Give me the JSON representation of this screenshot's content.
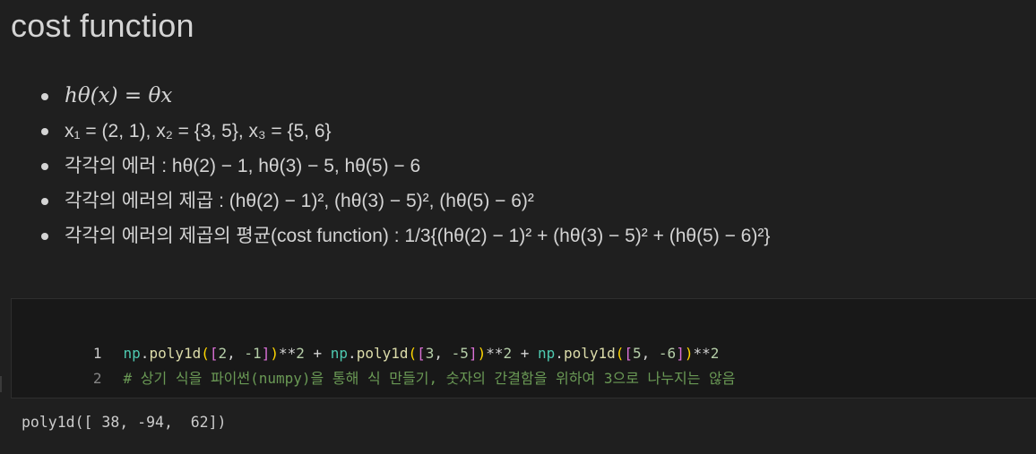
{
  "heading": "cost function",
  "bullets": [
    "hθ(x) = θx",
    "x₁ = (2, 1), x₂ = {3, 5}, x₃ = {5, 6}",
    "각각의 에러 : hθ(2) − 1, hθ(3) − 5, hθ(5) − 6",
    "각각의 에러의 제곱 : (hθ(2) − 1)², (hθ(3) − 5)², (hθ(5) − 6)²",
    "각각의 에러의 제곱의 평균(cost function) : 1/3{(hθ(2) − 1)² + (hθ(3) − 5)² + (hθ(5) − 6)²}"
  ],
  "code_cell": {
    "line_numbers": [
      "1",
      "2"
    ],
    "line1_tokens": [
      {
        "text": "np",
        "cls": "t-var"
      },
      {
        "text": ".",
        "cls": "t-op"
      },
      {
        "text": "poly1d",
        "cls": "t-fn"
      },
      {
        "text": "(",
        "cls": "t-b1"
      },
      {
        "text": "[",
        "cls": "t-b2"
      },
      {
        "text": "2",
        "cls": "t-num"
      },
      {
        "text": ", ",
        "cls": "t-op"
      },
      {
        "text": "-1",
        "cls": "t-num"
      },
      {
        "text": "]",
        "cls": "t-b2"
      },
      {
        "text": ")",
        "cls": "t-b1"
      },
      {
        "text": "**",
        "cls": "t-op"
      },
      {
        "text": "2",
        "cls": "t-num"
      },
      {
        "text": " + ",
        "cls": "t-op"
      },
      {
        "text": "np",
        "cls": "t-var"
      },
      {
        "text": ".",
        "cls": "t-op"
      },
      {
        "text": "poly1d",
        "cls": "t-fn"
      },
      {
        "text": "(",
        "cls": "t-b1"
      },
      {
        "text": "[",
        "cls": "t-b2"
      },
      {
        "text": "3",
        "cls": "t-num"
      },
      {
        "text": ", ",
        "cls": "t-op"
      },
      {
        "text": "-5",
        "cls": "t-num"
      },
      {
        "text": "]",
        "cls": "t-b2"
      },
      {
        "text": ")",
        "cls": "t-b1"
      },
      {
        "text": "**",
        "cls": "t-op"
      },
      {
        "text": "2",
        "cls": "t-num"
      },
      {
        "text": " + ",
        "cls": "t-op"
      },
      {
        "text": "np",
        "cls": "t-var"
      },
      {
        "text": ".",
        "cls": "t-op"
      },
      {
        "text": "poly1d",
        "cls": "t-fn"
      },
      {
        "text": "(",
        "cls": "t-b1"
      },
      {
        "text": "[",
        "cls": "t-b2"
      },
      {
        "text": "5",
        "cls": "t-num"
      },
      {
        "text": ", ",
        "cls": "t-op"
      },
      {
        "text": "-6",
        "cls": "t-num"
      },
      {
        "text": "]",
        "cls": "t-b2"
      },
      {
        "text": ")",
        "cls": "t-b1"
      },
      {
        "text": "**",
        "cls": "t-op"
      },
      {
        "text": "2",
        "cls": "t-num"
      }
    ],
    "line2_comment": "# 상기 식을 파이썬(numpy)을 통해 식 만들기, 숫자의 간결함을 위하여 3으로 나누지는 않음"
  },
  "output": "poly1d([ 38, -94,  62])",
  "colors": {
    "background": "#1f1f1f",
    "cell_background": "#181818",
    "comment": "#6a9955",
    "number": "#b5cea8",
    "function": "#dcdcaa",
    "variable": "#4ec9b0"
  }
}
